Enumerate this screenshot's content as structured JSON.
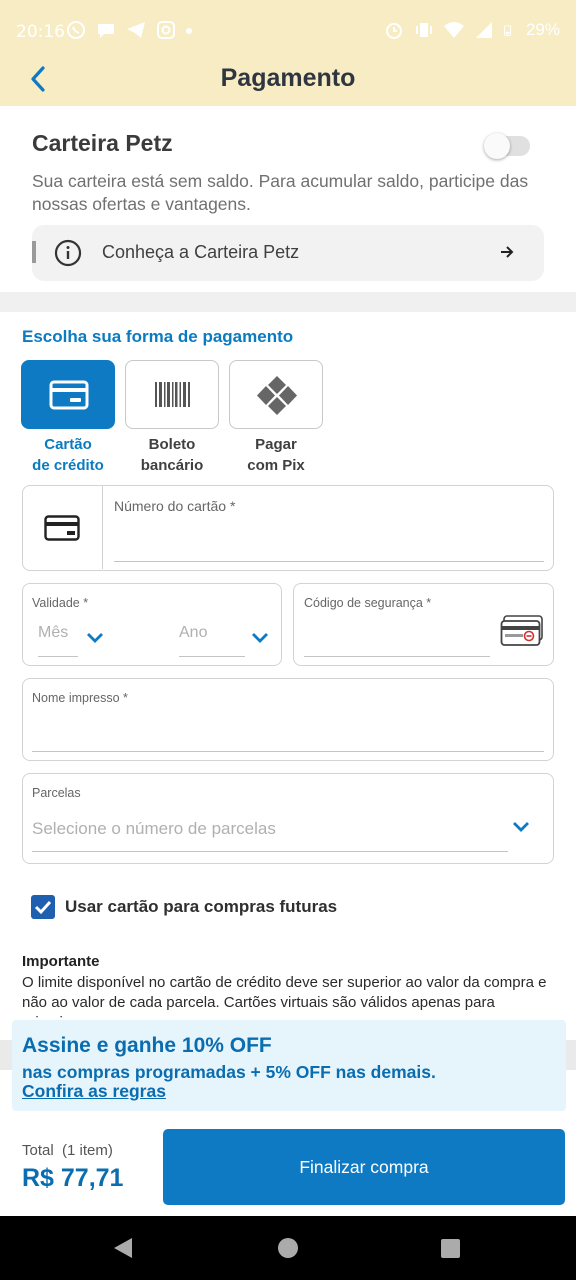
{
  "status_bar": {
    "time": "20:16",
    "battery": "29%",
    "left_icons": [
      "whatsapp-icon",
      "chat-icon",
      "telegram-icon",
      "instagram-icon",
      "dot-icon"
    ],
    "right_icons": [
      "alarm-icon",
      "vibrate-icon",
      "wifi-icon",
      "signal-icon",
      "battery-icon"
    ]
  },
  "header": {
    "title": "Pagamento"
  },
  "wallet": {
    "title": "Carteira Petz",
    "description": "Sua carteira está sem saldo. Para acumular saldo, participe das nossas ofertas e vantagens.",
    "link_label": "Conheça a Carteira Petz",
    "toggle_on": false
  },
  "payment": {
    "section_title": "Escolha sua forma de pagamento",
    "methods": [
      {
        "label": "Cartão de crédito",
        "line1": "Cartão",
        "line2": "de crédito",
        "selected": true
      },
      {
        "label": "Boleto bancário",
        "line1": "Boleto",
        "line2": "bancário",
        "selected": false
      },
      {
        "label": "Pagar com Pix",
        "line1": "Pagar",
        "line2": "com Pix",
        "selected": false
      }
    ]
  },
  "form": {
    "card_number_label": "Número do cartão *",
    "validity_label": "Validade *",
    "month_placeholder": "Mês",
    "year_placeholder": "Ano",
    "security_code_label": "Código de segurança *",
    "name_label": "Nome impresso *",
    "installments_label": "Parcelas",
    "installments_placeholder": "Selecione o número de parcelas",
    "save_card_label": "Usar cartão para compras futuras",
    "save_card_checked": true
  },
  "important": {
    "title": "Importante",
    "text": "O limite disponível no cartão de crédito deve ser superior ao valor da compra e não ao valor de cada parcela. Cartões virtuais são válidos apenas para primeira compra."
  },
  "promo": {
    "title": "Assine e ganhe 10% OFF",
    "subtitle": "nas compras programadas + 5% OFF nas demais.",
    "link": "Confira as regras"
  },
  "footer": {
    "total_label": "Total  (1 item)",
    "total_value": "R$ 77,71",
    "finish_button": "Finalizar compra"
  },
  "colors": {
    "header_bg": "#f8ecc4",
    "primary": "#0e7ac4",
    "link_blue": "#0a7bc1",
    "checkbox": "#1f5fb0"
  }
}
